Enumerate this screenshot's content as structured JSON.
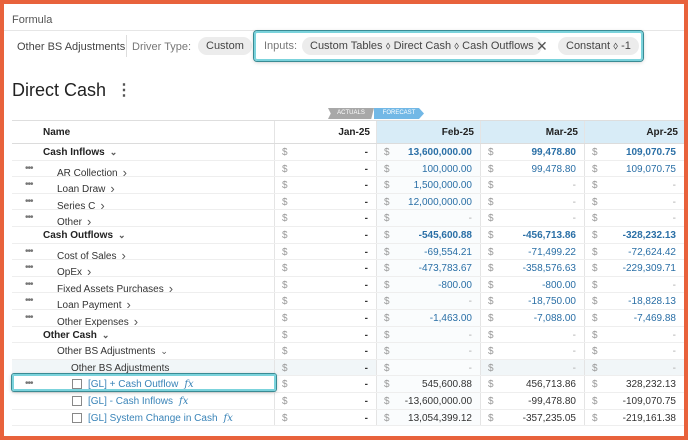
{
  "formula": {
    "title": "Formula",
    "item_label": "Other BS Adjustments",
    "driver_type_label": "Driver Type:",
    "driver_type_value": "Custom",
    "inputs_label": "Inputs:",
    "input_pill": "Custom Tables ⬨ Direct Cash ⬨ Cash Outflows",
    "remove_symbol": "✕",
    "constant_pill": "Constant ⬨ -1"
  },
  "page": {
    "title": "Direct Cash",
    "menu_symbol": "⋮",
    "tag_actuals": "ACTUALS",
    "tag_forecast": "FORECAST"
  },
  "table": {
    "columns": [
      "Name",
      "Jan-25",
      "Feb-25",
      "Mar-25",
      "Apr-25"
    ],
    "rows": [
      {
        "name": "Cash Inflows",
        "jan": "-",
        "feb": "13,600,000.00",
        "mar": "99,478.80",
        "apr": "109,070.75"
      },
      {
        "name": "AR Collection",
        "jan": "-",
        "feb": "100,000.00",
        "mar": "99,478.80",
        "apr": "109,070.75"
      },
      {
        "name": "Loan Draw",
        "jan": "-",
        "feb": "1,500,000.00",
        "mar": "-",
        "apr": "-"
      },
      {
        "name": "Series C",
        "jan": "-",
        "feb": "12,000,000.00",
        "mar": "-",
        "apr": "-"
      },
      {
        "name": "Other",
        "jan": "-",
        "feb": "-",
        "mar": "-",
        "apr": "-"
      },
      {
        "name": "Cash Outflows",
        "jan": "-",
        "feb": "-545,600.88",
        "mar": "-456,713.86",
        "apr": "-328,232.13"
      },
      {
        "name": "Cost of Sales",
        "jan": "-",
        "feb": "-69,554.21",
        "mar": "-71,499.22",
        "apr": "-72,624.42"
      },
      {
        "name": "OpEx",
        "jan": "-",
        "feb": "-473,783.67",
        "mar": "-358,576.63",
        "apr": "-229,309.71"
      },
      {
        "name": "Fixed Assets Purchases",
        "jan": "-",
        "feb": "-800.00",
        "mar": "-800.00",
        "apr": "-"
      },
      {
        "name": "Loan Payment",
        "jan": "-",
        "feb": "-",
        "mar": "-18,750.00",
        "apr": "-18,828.13"
      },
      {
        "name": "Other Expenses",
        "jan": "-",
        "feb": "-1,463.00",
        "mar": "-7,088.00",
        "apr": "-7,469.88"
      },
      {
        "name": "Other Cash",
        "jan": "-",
        "feb": "-",
        "mar": "-",
        "apr": "-"
      },
      {
        "name": "Other BS Adjustments",
        "jan": "-",
        "feb": "-",
        "mar": "-",
        "apr": "-"
      },
      {
        "name": "Other BS Adjustments",
        "jan": "-",
        "feb": "-",
        "mar": "-",
        "apr": "-"
      },
      {
        "name": "[GL] + Cash Outflow",
        "jan": "-",
        "feb": "545,600.88",
        "mar": "456,713.86",
        "apr": "328,232.13"
      },
      {
        "name": "[GL] - Cash Inflows",
        "jan": "-",
        "feb": "-13,600,000.00",
        "mar": "-99,478.80",
        "apr": "-109,070.75"
      },
      {
        "name": "[GL] System Change in Cash",
        "jan": "-",
        "feb": "13,054,399.12",
        "mar": "-357,235.05",
        "apr": "-219,161.38"
      }
    ],
    "currency_symbol": "$",
    "row_menu_symbol": "•••",
    "chevron_right": "›",
    "chevron_down": "⌄",
    "fx_symbol": "fx"
  }
}
